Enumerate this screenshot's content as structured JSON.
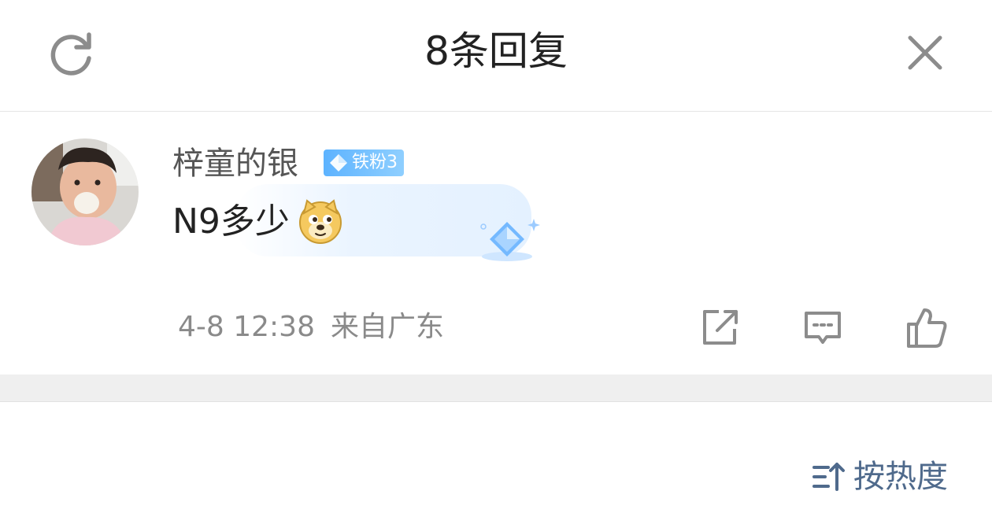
{
  "header": {
    "title": "8条回复",
    "refresh_icon": "refresh-icon",
    "close_icon": "close-icon"
  },
  "comment": {
    "username": "梓童的银",
    "badge": {
      "text": "铁粉3",
      "icon": "diamond-icon",
      "color": "#5db3ff"
    },
    "message": "N9多少",
    "emoji": "doge-emoji",
    "date": "4-8 12:38",
    "location": "来自广东",
    "actions": {
      "share_icon": "share-icon",
      "reply_icon": "comment-icon",
      "like_icon": "thumbs-up-icon"
    }
  },
  "footer": {
    "sort_label": "按热度",
    "sort_icon": "sort-icon",
    "sort_color": "#4f6a8c"
  }
}
